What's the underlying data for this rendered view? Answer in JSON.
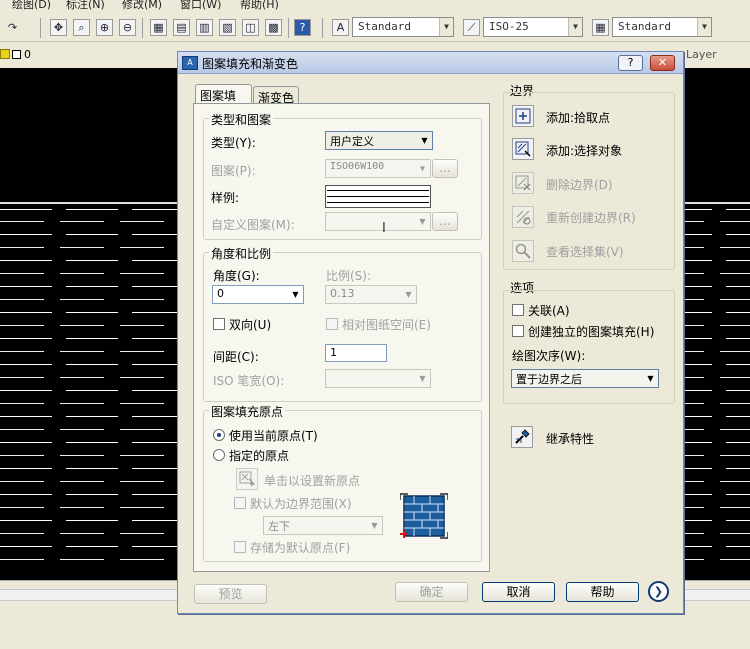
{
  "app": {
    "menu": [
      "绘图(D)",
      "标注(N)",
      "修改(M)",
      "窗口(W)",
      "帮助(H)"
    ],
    "text_style": "Standard",
    "dim_style": "ISO-25",
    "table_style": "Standard",
    "layer_value": "0",
    "layer_label": "Layer"
  },
  "dialog": {
    "title": "图案填充和渐变色",
    "help_btn": "?",
    "close_btn": "✕",
    "tabs": [
      "图案填充",
      "渐变色"
    ],
    "type_pattern": {
      "legend": "类型和图案",
      "type_label": "类型(Y):",
      "type_value": "用户定义",
      "pattern_label": "图案(P):",
      "pattern_value": "ISO06W100",
      "pattern_more": "...",
      "sample_label": "样例:",
      "custom_label": "自定义图案(M):",
      "custom_more": "..."
    },
    "angle_scale": {
      "legend": "角度和比例",
      "angle_label": "角度(G):",
      "angle_value": "0",
      "scale_label": "比例(S):",
      "scale_value": "0.13",
      "double_label": "双向(U)",
      "relative_label": "相对图纸空间(E)",
      "spacing_label": "间距(C):",
      "spacing_value": "1",
      "iso_label": "ISO 笔宽(O):"
    },
    "origin": {
      "legend": "图案填充原点",
      "use_current": "使用当前原点(T)",
      "specified": "指定的原点",
      "click_set": "单击以设置新原点",
      "default_extent": "默认为边界范围(X)",
      "position_value": "左下",
      "store_default": "存储为默认原点(F)"
    },
    "boundary": {
      "legend": "边界",
      "add_pick": "添加:拾取点",
      "add_select": "添加:选择对象",
      "remove": "删除边界(D)",
      "recreate": "重新创建边界(R)",
      "view_selection": "查看选择集(V)"
    },
    "options": {
      "legend": "选项",
      "associative": "关联(A)",
      "independent": "创建独立的图案填充(H)",
      "draw_order_label": "绘图次序(W):",
      "draw_order_value": "置于边界之后"
    },
    "inherit": "继承特性",
    "footer": {
      "preview": "预览",
      "ok": "确定",
      "cancel": "取消",
      "help": "帮助"
    }
  }
}
